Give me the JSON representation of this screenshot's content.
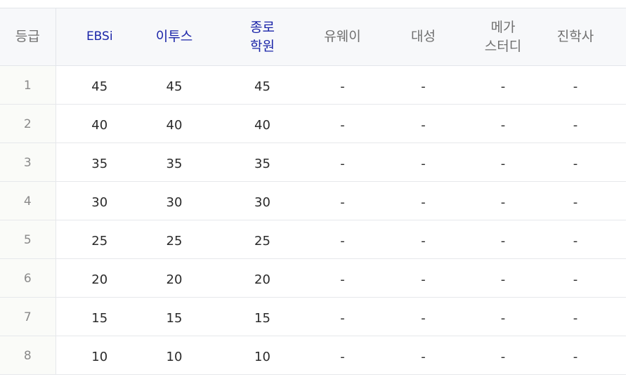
{
  "table": {
    "headers": {
      "grade": "등급",
      "ebsi": "EBSi",
      "etoos": "이투스",
      "jongro_line1": "종로",
      "jongro_line2": "학원",
      "uway": "유웨이",
      "daesung": "대성",
      "mega_line1": "메가",
      "mega_line2": "스터디",
      "jinhak": "진학사"
    },
    "rows": [
      {
        "grade": "1",
        "ebsi": "45",
        "etoos": "45",
        "jongro": "45",
        "uway": "-",
        "daesung": "-",
        "mega": "-",
        "jinhak": "-"
      },
      {
        "grade": "2",
        "ebsi": "40",
        "etoos": "40",
        "jongro": "40",
        "uway": "-",
        "daesung": "-",
        "mega": "-",
        "jinhak": "-"
      },
      {
        "grade": "3",
        "ebsi": "35",
        "etoos": "35",
        "jongro": "35",
        "uway": "-",
        "daesung": "-",
        "mega": "-",
        "jinhak": "-"
      },
      {
        "grade": "4",
        "ebsi": "30",
        "etoos": "30",
        "jongro": "30",
        "uway": "-",
        "daesung": "-",
        "mega": "-",
        "jinhak": "-"
      },
      {
        "grade": "5",
        "ebsi": "25",
        "etoos": "25",
        "jongro": "25",
        "uway": "-",
        "daesung": "-",
        "mega": "-",
        "jinhak": "-"
      },
      {
        "grade": "6",
        "ebsi": "20",
        "etoos": "20",
        "jongro": "20",
        "uway": "-",
        "daesung": "-",
        "mega": "-",
        "jinhak": "-"
      },
      {
        "grade": "7",
        "ebsi": "15",
        "etoos": "15",
        "jongro": "15",
        "uway": "-",
        "daesung": "-",
        "mega": "-",
        "jinhak": "-"
      },
      {
        "grade": "8",
        "ebsi": "10",
        "etoos": "10",
        "jongro": "10",
        "uway": "-",
        "daesung": "-",
        "mega": "-",
        "jinhak": "-"
      }
    ]
  },
  "colors": {
    "highlight_header": "#1a24a8",
    "header_text": "#6f6f6f",
    "header_background": "#f7f8fa",
    "border": "#e3e6ea"
  }
}
